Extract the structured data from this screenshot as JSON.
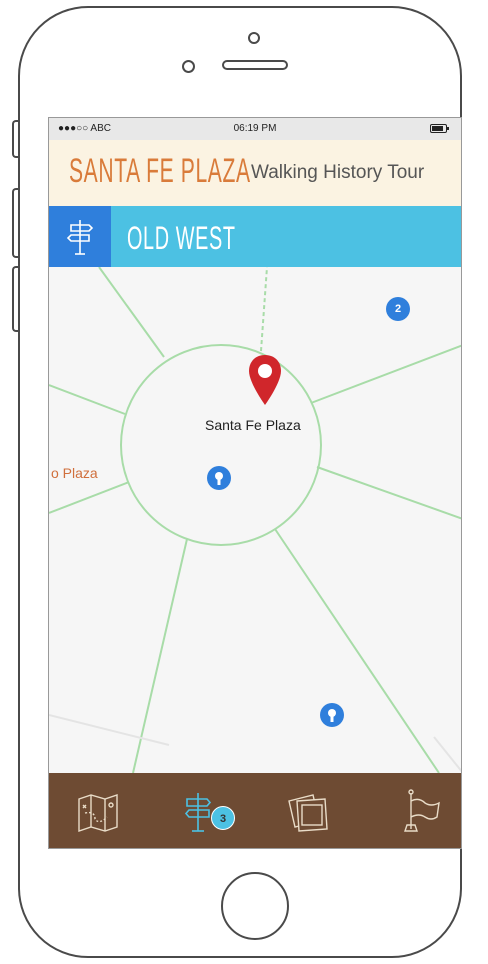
{
  "status_bar": {
    "carrier": "●●●○○ ABC",
    "time": "06:19 PM"
  },
  "header": {
    "title": "SANTA FE PLAZA",
    "subtitle": "Walking History Tour"
  },
  "section": {
    "title": "OLD WEST",
    "icon": "signpost-icon"
  },
  "map": {
    "selected_pin_label": "Santa Fe Plaza",
    "street_label": "o Plaza",
    "cluster_badge": "2"
  },
  "tabbar": {
    "tabs": [
      {
        "icon": "map-icon"
      },
      {
        "icon": "signpost-icon",
        "badge": "3"
      },
      {
        "icon": "photos-icon"
      },
      {
        "icon": "flag-icon"
      }
    ]
  },
  "colors": {
    "header_bg": "#fbf3e2",
    "title_orange": "#d97b3a",
    "section_blue": "#4cc1e3",
    "icon_blue": "#2f7fdc",
    "tabbar_brown": "#6e4b33",
    "pin_red": "#d0262b",
    "road_green": "#a8dca8"
  }
}
